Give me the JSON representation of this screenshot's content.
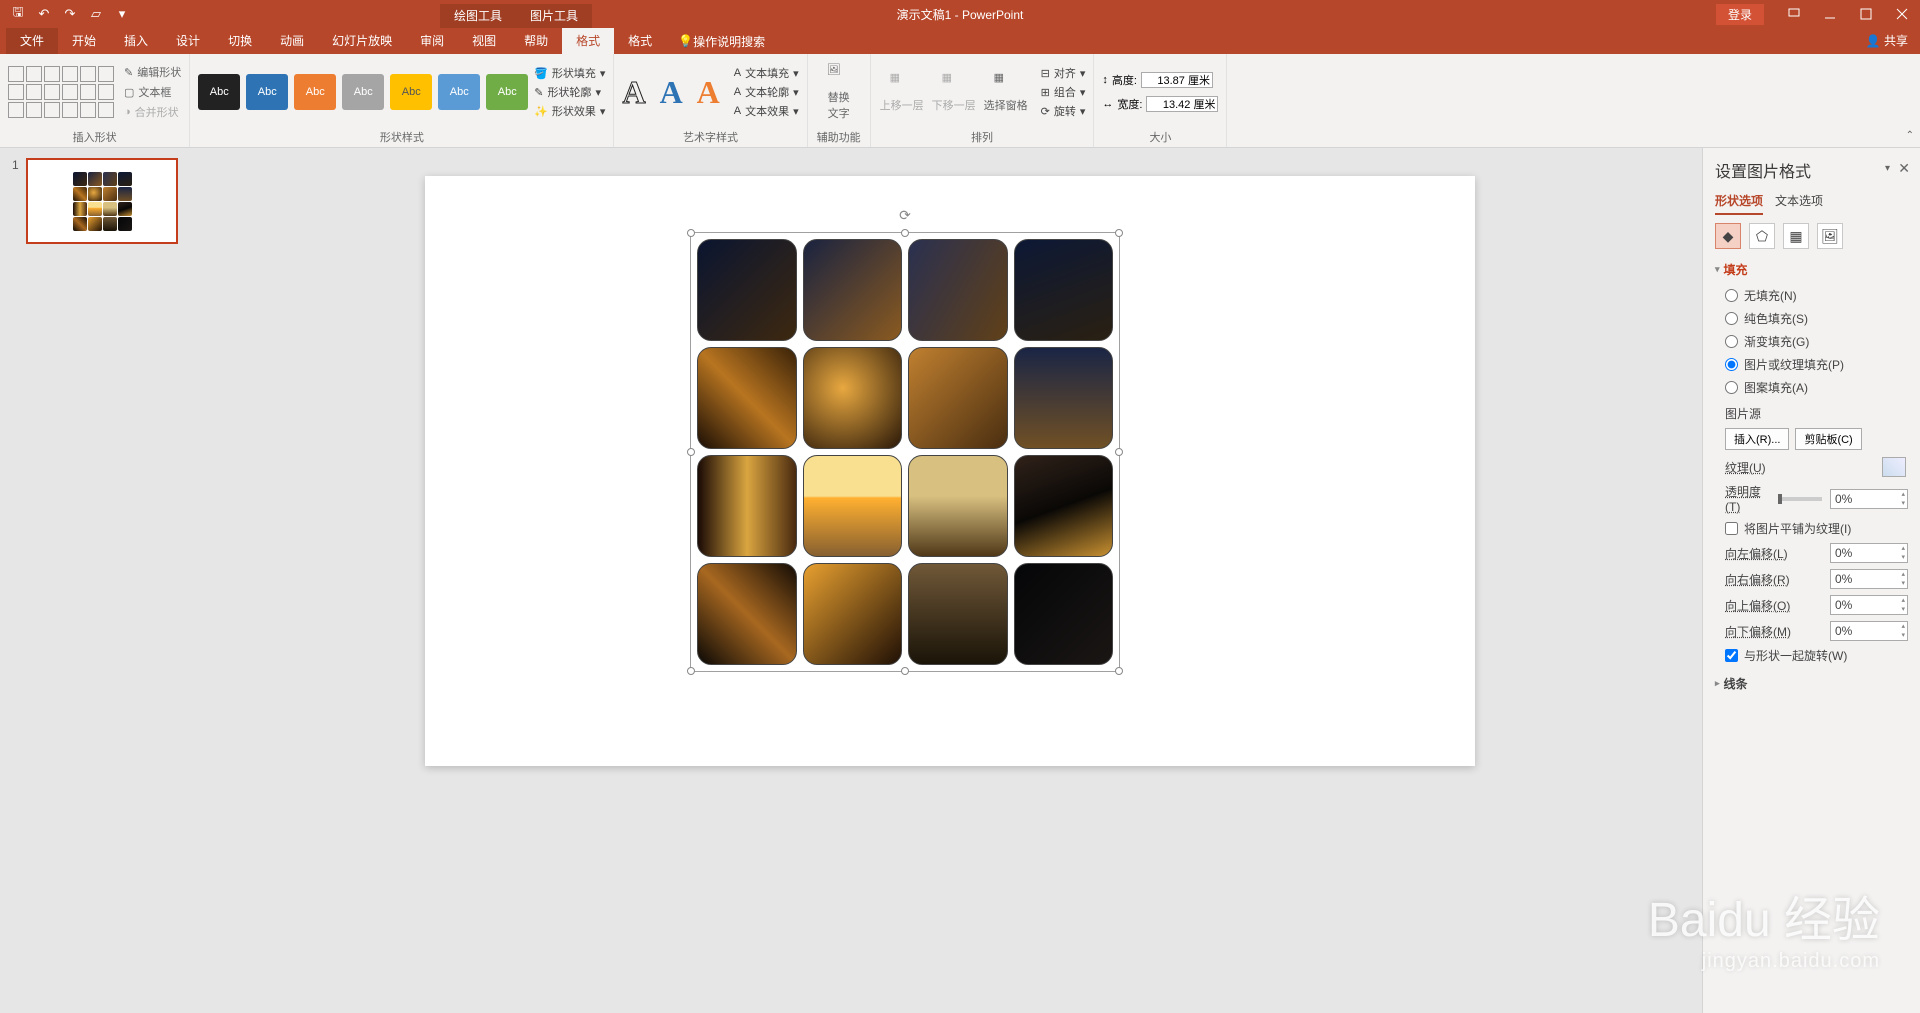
{
  "app": {
    "title": "演示文稿1 - PowerPoint",
    "login": "登录",
    "share": "共享"
  },
  "context_tabs": {
    "drawing": "绘图工具",
    "picture": "图片工具"
  },
  "tabs": {
    "file": "文件",
    "home": "开始",
    "insert": "插入",
    "design": "设计",
    "transitions": "切换",
    "animations": "动画",
    "slideshow": "幻灯片放映",
    "review": "审阅",
    "view": "视图",
    "help": "帮助",
    "format1": "格式",
    "format2": "格式",
    "tellme": "操作说明搜索"
  },
  "ribbon": {
    "groups": {
      "insert_shapes": "插入形状",
      "shape_styles": "形状样式",
      "wordart": "艺术字样式",
      "accessibility": "辅助功能",
      "arrange": "排列",
      "size": "大小"
    },
    "shape_opts": {
      "edit": "编辑形状",
      "textbox": "文本框",
      "merge": "合并形状"
    },
    "swatch_label": "Abc",
    "shape_fmt": {
      "fill": "形状填充",
      "outline": "形状轮廓",
      "effects": "形状效果"
    },
    "text_fmt": {
      "fill": "文本填充",
      "outline": "文本轮廓",
      "effects": "文本效果"
    },
    "alt_text": "替换\n文字",
    "arrange": {
      "forward": "上移一层",
      "backward": "下移一层",
      "pane": "选择窗格",
      "align": "对齐",
      "group": "组合",
      "rotate": "旋转"
    },
    "size": {
      "h_label": "高度:",
      "h_val": "13.87 厘米",
      "w_label": "宽度:",
      "w_val": "13.42 厘米"
    }
  },
  "thumbs": {
    "num": "1"
  },
  "pane": {
    "title": "设置图片格式",
    "tab_shape": "形状选项",
    "tab_text": "文本选项",
    "section_fill": "填充",
    "section_line": "线条",
    "fill": {
      "none": "无填充(N)",
      "solid": "纯色填充(S)",
      "gradient": "渐变填充(G)",
      "picture": "图片或纹理填充(P)",
      "pattern": "图案填充(A)"
    },
    "pic_src": "图片源",
    "insert_btn": "插入(R)...",
    "clip_btn": "剪贴板(C)",
    "texture": "纹理(U)",
    "trans_label": "透明度(T)",
    "trans_val": "0%",
    "tile": "将图片平铺为纹理(I)",
    "off_l": "向左偏移(L)",
    "off_r": "向右偏移(R)",
    "off_t": "向上偏移(O)",
    "off_b": "向下偏移(M)",
    "off_val": "0%",
    "rotate_with": "与形状一起旋转(W)"
  },
  "watermark": {
    "brand": "Baidu 经验",
    "url": "jingyan.baidu.com"
  }
}
